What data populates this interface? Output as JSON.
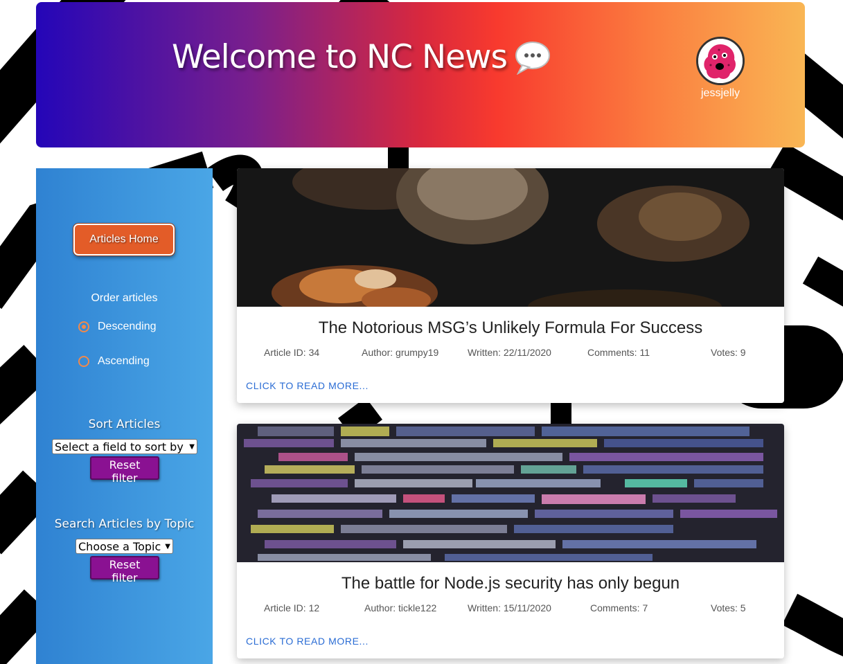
{
  "header": {
    "title": "Welcome to NC News",
    "title_icon": "speech-bubble-icon",
    "username": "jessjelly",
    "avatar_icon": "pink-blob-avatar"
  },
  "sidebar": {
    "home_button": "Articles Home",
    "order_label": "Order articles",
    "order_options": [
      {
        "label": "Descending",
        "checked": true
      },
      {
        "label": "Ascending",
        "checked": false
      }
    ],
    "sort_label": "Sort Articles",
    "sort_select": "Select a field to sort by",
    "reset_sort": "Reset filter",
    "topic_label": "Search Articles by Topic",
    "topic_select": "Choose a Topic",
    "reset_topic": "Reset filter"
  },
  "articles": [
    {
      "title": "The Notorious MSG’s Unlikely Formula For Success",
      "id": "Article ID: 34",
      "author": "Author: grumpy19",
      "written": "Written: 22/11/2020",
      "comments": "Comments: 11",
      "votes": "Votes: 9",
      "read_more": "CLICK TO READ MORE..."
    },
    {
      "title": "The battle for Node.js security has only begun",
      "id": "Article ID: 12",
      "author": "Author: tickle122",
      "written": "Written: 15/11/2020",
      "comments": "Comments: 7",
      "votes": "Votes: 5",
      "read_more": "CLICK TO READ MORE..."
    }
  ],
  "colors": {
    "accent_orange": "#e35c28",
    "reset_purple": "#8a1192",
    "link_blue": "#2a6cd4",
    "sidebar_blue": "#2f82d2"
  }
}
